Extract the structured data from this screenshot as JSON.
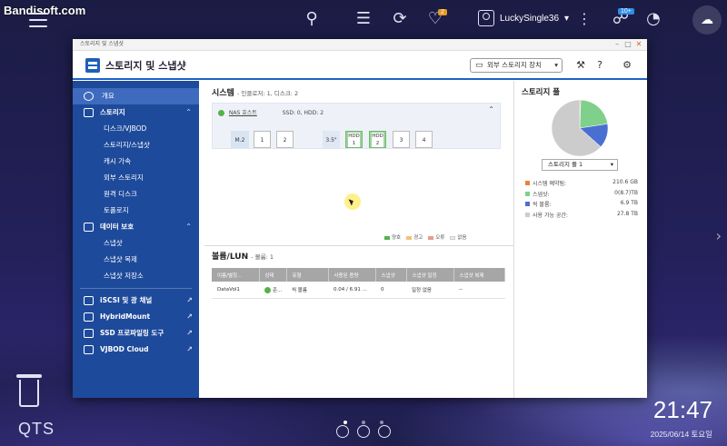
{
  "watermark": "Bandisoft.com",
  "taskbar": {
    "notify_badge": "2",
    "username": "LuckySingle36",
    "user_caret": "▾",
    "ext_badge": "10+"
  },
  "window": {
    "title_small": "스토리지 및 스냅샷",
    "app_title": "스토리지 및 스냅샷",
    "ext_storage_button": "외부 스토리지 장치"
  },
  "sidebar": {
    "overview": "개요",
    "storage": "스토리지",
    "storage_items": [
      "디스크/VJBOD",
      "스토리지/스냅샷",
      "캐시 가속",
      "외부 스토리지",
      "원격 디스크",
      "토폴로지"
    ],
    "protection": "데이터 보호",
    "protection_items": [
      "스냅샷",
      "스냅샷 복제",
      "스냅샷 저장소"
    ],
    "links": [
      "iSCSI 및 광 채널",
      "HybridMount",
      "SSD 프로파일링 도구",
      "VJBOD Cloud"
    ]
  },
  "system": {
    "title": "시스템",
    "subtitle": "- 인클로저: 1, 디스크: 2",
    "nas_host": "NAS 호스트",
    "ssd_hdd": "SSD: 0, HDD: 2",
    "slots": {
      "m2_label": "M.2",
      "m2_1": "1",
      "m2_2": "2",
      "bay_label": "3.5\"",
      "hdd_label": "HDD",
      "bay_1": "1",
      "bay_2": "2",
      "bay_3": "3",
      "bay_4": "4"
    },
    "legend": [
      "양호",
      "경고",
      "오류",
      "없음"
    ]
  },
  "volumes": {
    "title": "볼륨/LUN",
    "subtitle": "- 볼륨: 1",
    "columns": [
      "이름/별칭...",
      "상태",
      "유형",
      "사용된 용량",
      "스냅샷",
      "스냅샷 일정",
      "스냅샷 복제"
    ],
    "rows": [
      {
        "name": "DataVol1",
        "status": "준...",
        "type": "씩 볼륨",
        "used": "0.04 / 6.91 ...",
        "snapshots": "0",
        "schedule": "일정 없음",
        "replica": "--"
      }
    ]
  },
  "pool": {
    "title": "스토리지 풀",
    "selected": "스토리지 풀 1",
    "stats": [
      {
        "label": "시스템 예약됨:",
        "value": "210.6 GB",
        "color": "#e8843a"
      },
      {
        "label": "스냅샷:",
        "value": "0(8.7)TB",
        "color": "#7fd08a"
      },
      {
        "label": "씩 볼륨:",
        "value": "6.9 TB",
        "color": "#4a6fd1"
      },
      {
        "label": "사용 가능 공간:",
        "value": "27.8 TB",
        "color": "#cccccc"
      }
    ]
  },
  "desktop": {
    "qts": "QTS",
    "time": "21:47",
    "date": "2025/06/14 토요일"
  }
}
